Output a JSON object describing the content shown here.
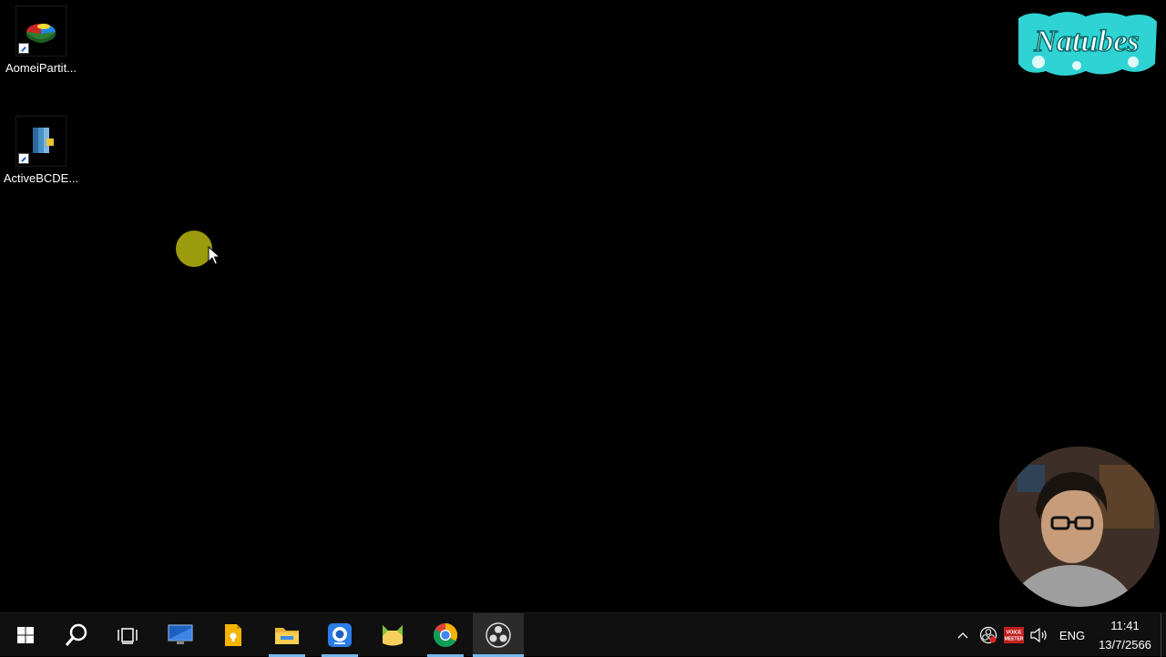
{
  "desktop": {
    "icons": [
      {
        "label": "AomeiPartit...",
        "icon": "aomei-partition-icon"
      },
      {
        "label": "ActiveBCDE...",
        "icon": "active-bcd-editor-icon"
      }
    ]
  },
  "overlay": {
    "logo_text": "Natubes",
    "logo_color": "#2fd3d3"
  },
  "taskbar": {
    "accent": "#76b9ed",
    "buttons": [
      {
        "name": "start-button",
        "icon": "windows-logo-icon"
      },
      {
        "name": "search-button",
        "icon": "search-icon"
      },
      {
        "name": "task-view-button",
        "icon": "task-view-icon"
      },
      {
        "name": "remote-desktop-button",
        "icon": "monitor-icon"
      },
      {
        "name": "keep-notes-button",
        "icon": "note-icon"
      },
      {
        "name": "file-explorer-button",
        "icon": "folder-icon"
      },
      {
        "name": "webcam-app-button",
        "icon": "webcam-icon"
      },
      {
        "name": "cat-app-button",
        "icon": "cat-icon"
      },
      {
        "name": "chrome-button",
        "icon": "chrome-icon"
      },
      {
        "name": "obs-button",
        "icon": "obs-icon"
      }
    ],
    "tray": {
      "chevron": "^",
      "voicemeeter_label": "VOICE MEETER",
      "language": "ENG",
      "time": "11:41",
      "date": "13/7/2566"
    }
  }
}
